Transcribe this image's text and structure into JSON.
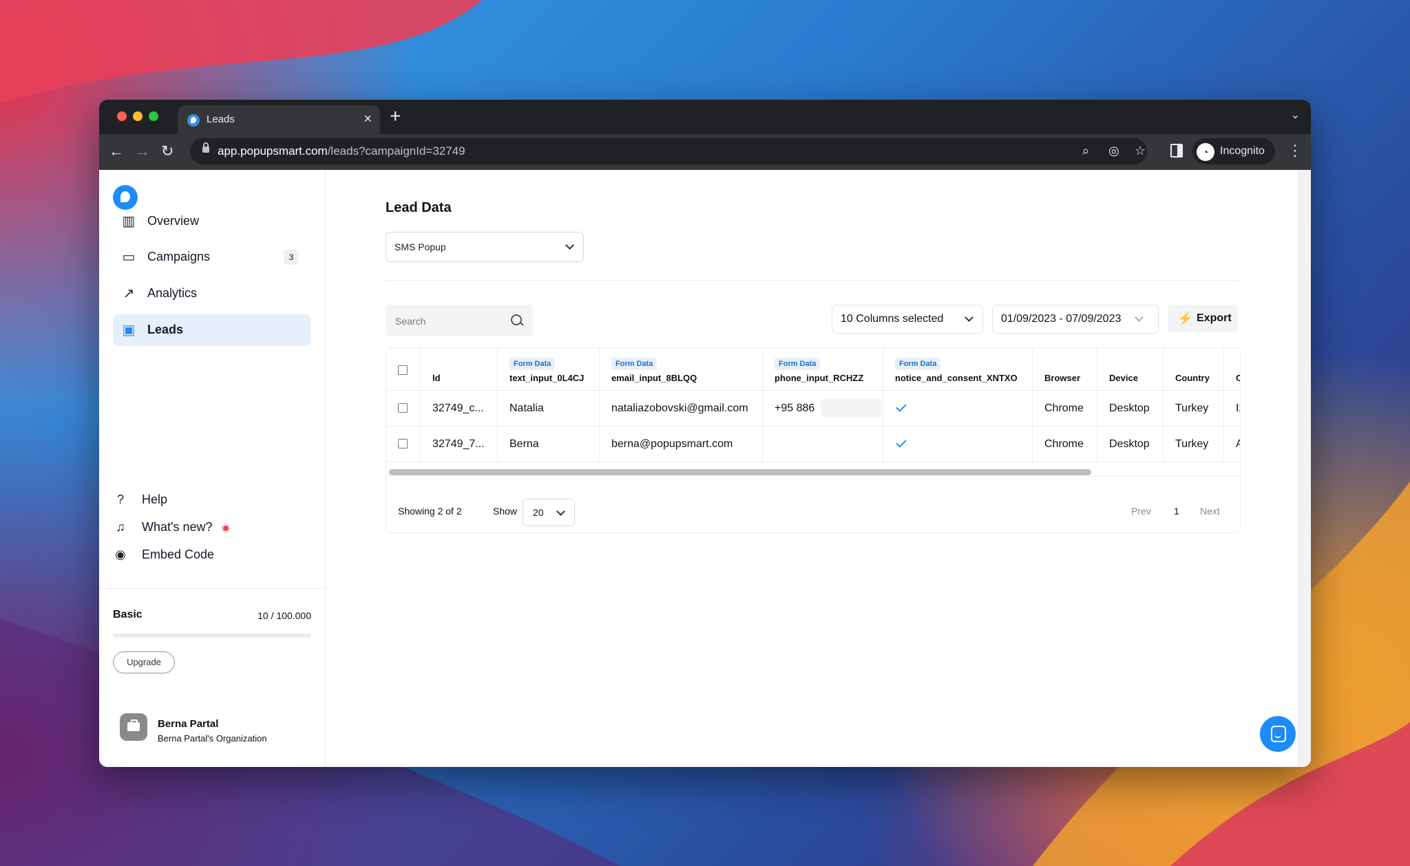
{
  "browser": {
    "tab_title": "Leads",
    "url_host": "app.popupsmart.com",
    "url_path": "/leads?campaignId=32749",
    "profile_label": "Incognito"
  },
  "sidebar": {
    "items": [
      {
        "label": "Overview",
        "icon": "chart-icon"
      },
      {
        "label": "Campaigns",
        "icon": "folder-icon",
        "badge": "3"
      },
      {
        "label": "Analytics",
        "icon": "trend-icon"
      },
      {
        "label": "Leads",
        "icon": "leads-folder-icon",
        "active": true
      }
    ],
    "secondary": [
      {
        "label": "Help",
        "icon": "help-icon"
      },
      {
        "label": "What's new?",
        "icon": "bell-icon"
      },
      {
        "label": "Embed Code",
        "icon": "embed-icon"
      }
    ],
    "plan": {
      "name": "Basic",
      "usage": "10 / 100.000",
      "usage_fraction": 0.0001,
      "upgrade_label": "Upgrade"
    },
    "user": {
      "name": "Berna Partal",
      "org": "Berna Partal's Organization"
    }
  },
  "main": {
    "title": "Lead Data",
    "campaign_select": "SMS Popup",
    "search_placeholder": "Search",
    "columns_select": "10 Columns selected",
    "date_range": "01/09/2023 - 07/09/2023",
    "export_label": "Export"
  },
  "table": {
    "tag": "Form Data",
    "columns": [
      {
        "label": "Id",
        "tag": false
      },
      {
        "label": "text_input_0L4CJ",
        "tag": true
      },
      {
        "label": "email_input_8BLQQ",
        "tag": true
      },
      {
        "label": "phone_input_RCHZZ",
        "tag": true
      },
      {
        "label": "notice_and_consent_XNTXO",
        "tag": true
      },
      {
        "label": "Browser",
        "tag": false
      },
      {
        "label": "Device",
        "tag": false
      },
      {
        "label": "Country",
        "tag": false
      },
      {
        "label": "C",
        "tag": false
      }
    ],
    "rows": [
      {
        "id": "32749_c...",
        "text": "Natalia",
        "email": "nataliazobovski@gmail.com",
        "phone": "+95 886",
        "consent": true,
        "browser": "Chrome",
        "device": "Desktop",
        "country": "Turkey",
        "extra": "Iz"
      },
      {
        "id": "32749_7...",
        "text": "Berna",
        "email": "berna@popupsmart.com",
        "phone": "",
        "consent": true,
        "browser": "Chrome",
        "device": "Desktop",
        "country": "Turkey",
        "extra": "A"
      }
    ]
  },
  "pagination": {
    "showing": "Showing 2 of 2",
    "show_label": "Show",
    "page_size": "20",
    "prev": "Prev",
    "page": "1",
    "next": "Next"
  },
  "colors": {
    "accent": "#1d8cf8",
    "active_bg": "#e6f0fb",
    "browser_dark": "#202124"
  }
}
